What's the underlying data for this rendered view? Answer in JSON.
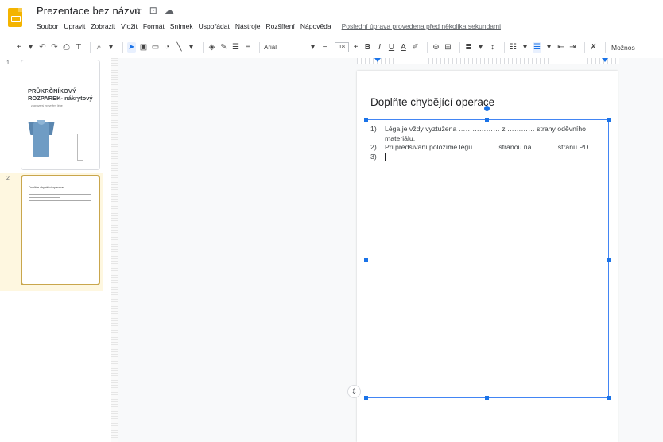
{
  "app": {
    "title": "Prezentace bez názvu",
    "title_icons": [
      "☆",
      "⊡",
      "☁"
    ]
  },
  "menu": {
    "items": [
      "Soubor",
      "Upravit",
      "Zobrazit",
      "Vložit",
      "Formát",
      "Snímek",
      "Uspořádat",
      "Nástroje",
      "Rozšíření",
      "Nápověda"
    ],
    "last_edit": "Poslední úprava provedena před několika sekundami"
  },
  "toolbar": {
    "font": "Arial",
    "font_size": "18",
    "more_label": "Možnos"
  },
  "thumbnails": [
    {
      "num": "1",
      "title": "PRŮKRČNÍKOVÝ ROZPAREK- nákrytový",
      "subtitle": "zapravený zpevněný lége"
    },
    {
      "num": "2",
      "title": "Doplňte chybějící operace"
    }
  ],
  "slide": {
    "title": "Doplňte chybějící operace",
    "items": [
      {
        "num": "1)",
        "text": "Léga je vždy vyztužena ……………… z ………… strany oděvního materiálu."
      },
      {
        "num": "2)",
        "text": "Při předšívání položíme légu ………. stranou na ………. stranu PD."
      },
      {
        "num": "3)",
        "text": ""
      }
    ]
  }
}
